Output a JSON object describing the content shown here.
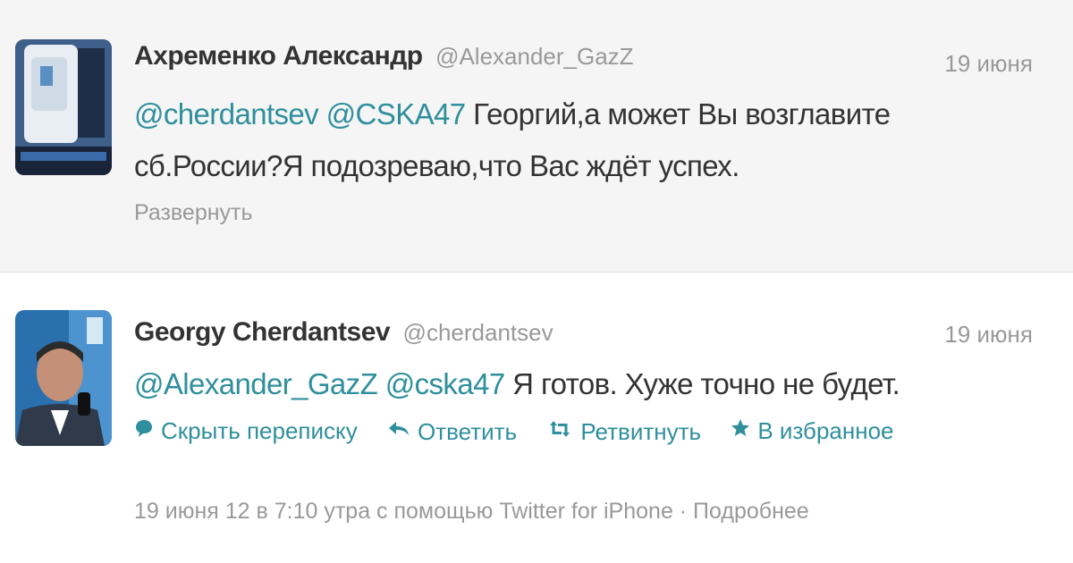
{
  "tweets": [
    {
      "fullname": "Ахременко Александр",
      "username": "@Alexander_GazZ",
      "date": "19 июня",
      "text_line1_mention1": "@cherdantsev",
      "text_line1_mention2": "@CSKA47",
      "text_line1_rest": "Георгий,а может Вы возглавите",
      "text_line2": "сб.России?Я подозреваю,что Вас ждёт успех.",
      "expand_label": "Развернуть"
    },
    {
      "fullname": "Georgy Cherdantsev",
      "username": "@cherdantsev",
      "date": "19 июня",
      "text_mention1": "@Alexander_GazZ",
      "text_mention2": "@cska47",
      "text_rest": "Я готов. Хуже точно не будет.",
      "actions": {
        "hide_conversation": "Скрыть переписку",
        "reply": "Ответить",
        "retweet": "Ретвитнуть",
        "favorite": "В избранное"
      },
      "meta": "19 июня 12 в 7:10 утра с помощью Twitter for iPhone · Подробнее"
    }
  ],
  "colors": {
    "link": "#2f8f9d",
    "muted": "#999999",
    "text": "#333333",
    "first_tweet_bg": "#f5f5f5"
  },
  "icons": {
    "hide_conversation": "speech-bubble-icon",
    "reply": "reply-arrow-icon",
    "retweet": "retweet-icon",
    "favorite": "star-icon"
  }
}
